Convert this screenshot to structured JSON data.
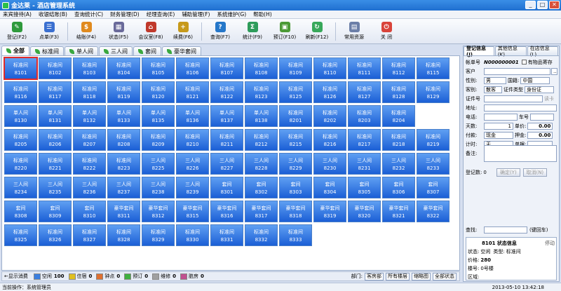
{
  "window": {
    "title": "金达莱 - 酒店管理系统"
  },
  "menu": [
    "来宾接待(A)",
    "收银结账(B)",
    "查询统计(C)",
    "财务管理(D)",
    "经理查询(E)",
    "辅助管理(F)",
    "系统维护(G)",
    "帮助(H)"
  ],
  "toolbar": [
    {
      "label": "登记(F2)",
      "icon": "register-icon",
      "color": "#2f9a3c"
    },
    {
      "label": "点单(F3)",
      "icon": "order-icon",
      "color": "#3a6fd0"
    },
    {
      "label": "结账(F4)",
      "icon": "checkout-icon",
      "color": "#e08a1e"
    },
    {
      "label": "状态(F5)",
      "icon": "status-icon",
      "color": "#6a6a9a"
    },
    {
      "label": "会议室(F8)",
      "icon": "meeting-icon",
      "color": "#c0392b"
    },
    {
      "label": "续费(F6)",
      "icon": "renew-icon",
      "color": "#c79a1a"
    },
    {
      "label": "查询(F7)",
      "icon": "query-icon",
      "color": "#2577c9"
    },
    {
      "label": "统计(F9)",
      "icon": "stats-icon",
      "color": "#2e9c5a"
    },
    {
      "label": "预订(F10)",
      "icon": "booking-icon",
      "color": "#4c9a36"
    },
    {
      "label": "刷新(F12)",
      "icon": "refresh-icon",
      "color": "#38a85a"
    },
    {
      "label": "常用资源",
      "icon": "resources-icon",
      "color": "#6c7fa8"
    },
    {
      "label": "关 闭",
      "icon": "close-app-icon",
      "color": "#d9443a"
    }
  ],
  "room_tabs": [
    "全部",
    "标准间",
    "单人间",
    "三人间",
    "套间",
    "豪华套间"
  ],
  "rooms": [
    {
      "t": "标准间",
      "n": "8101"
    },
    {
      "t": "标准间",
      "n": "8102"
    },
    {
      "t": "标准间",
      "n": "8103"
    },
    {
      "t": "标准间",
      "n": "8104"
    },
    {
      "t": "标准间",
      "n": "8105"
    },
    {
      "t": "标准间",
      "n": "8106"
    },
    {
      "t": "标准间",
      "n": "8107"
    },
    {
      "t": "标准间",
      "n": "8108"
    },
    {
      "t": "标准间",
      "n": "8109"
    },
    {
      "t": "标准间",
      "n": "8110"
    },
    {
      "t": "标准间",
      "n": "8111"
    },
    {
      "t": "标准间",
      "n": "8112"
    },
    {
      "t": "标准间",
      "n": "8115"
    },
    {
      "t": "标准间",
      "n": "8116"
    },
    {
      "t": "标准间",
      "n": "8117"
    },
    {
      "t": "标准间",
      "n": "8118"
    },
    {
      "t": "标准间",
      "n": "8119"
    },
    {
      "t": "标准间",
      "n": "8120"
    },
    {
      "t": "标准间",
      "n": "8121"
    },
    {
      "t": "标准间",
      "n": "8122"
    },
    {
      "t": "标准间",
      "n": "8123"
    },
    {
      "t": "标准间",
      "n": "8125"
    },
    {
      "t": "标准间",
      "n": "8126"
    },
    {
      "t": "标准间",
      "n": "8127"
    },
    {
      "t": "标准间",
      "n": "8128"
    },
    {
      "t": "标准间",
      "n": "8129"
    },
    {
      "t": "单人间",
      "n": "8130"
    },
    {
      "t": "单人间",
      "n": "8131"
    },
    {
      "t": "单人间",
      "n": "8132"
    },
    {
      "t": "单人间",
      "n": "8133"
    },
    {
      "t": "单人间",
      "n": "8135"
    },
    {
      "t": "单人间",
      "n": "8136"
    },
    {
      "t": "单人间",
      "n": "8137"
    },
    {
      "t": "单人间",
      "n": "8138"
    },
    {
      "t": "标准间",
      "n": "8201"
    },
    {
      "t": "标准间",
      "n": "8202"
    },
    {
      "t": "标准间",
      "n": "8203"
    },
    {
      "t": "标准间",
      "n": "8204"
    },
    {
      "t": "标准间",
      "n": "8205"
    },
    {
      "t": "标准间",
      "n": "8206"
    },
    {
      "t": "标准间",
      "n": "8207"
    },
    {
      "t": "标准间",
      "n": "8208"
    },
    {
      "t": "标准间",
      "n": "8209"
    },
    {
      "t": "标准间",
      "n": "8210"
    },
    {
      "t": "标准间",
      "n": "8211"
    },
    {
      "t": "标准间",
      "n": "8212"
    },
    {
      "t": "标准间",
      "n": "8215"
    },
    {
      "t": "标准间",
      "n": "8216"
    },
    {
      "t": "标准间",
      "n": "8217"
    },
    {
      "t": "标准间",
      "n": "8218"
    },
    {
      "t": "标准间",
      "n": "8219"
    },
    {
      "t": "标准间",
      "n": "8220"
    },
    {
      "t": "标准间",
      "n": "8221"
    },
    {
      "t": "标准间",
      "n": "8222"
    },
    {
      "t": "标准间",
      "n": "8223"
    },
    {
      "t": "三人间",
      "n": "8225"
    },
    {
      "t": "三人间",
      "n": "8226"
    },
    {
      "t": "三人间",
      "n": "8227"
    },
    {
      "t": "三人间",
      "n": "8228"
    },
    {
      "t": "三人间",
      "n": "8229"
    },
    {
      "t": "三人间",
      "n": "8230"
    },
    {
      "t": "三人间",
      "n": "8231"
    },
    {
      "t": "三人间",
      "n": "8232"
    },
    {
      "t": "三人间",
      "n": "8233"
    },
    {
      "t": "三人间",
      "n": "8234"
    },
    {
      "t": "三人间",
      "n": "8235"
    },
    {
      "t": "三人间",
      "n": "8236"
    },
    {
      "t": "三人间",
      "n": "8237"
    },
    {
      "t": "三人间",
      "n": "8238"
    },
    {
      "t": "三人间",
      "n": "8239"
    },
    {
      "t": "套间",
      "n": "8301"
    },
    {
      "t": "套间",
      "n": "8302"
    },
    {
      "t": "套间",
      "n": "8303"
    },
    {
      "t": "套间",
      "n": "8304"
    },
    {
      "t": "套间",
      "n": "8305"
    },
    {
      "t": "套间",
      "n": "8306"
    },
    {
      "t": "套间",
      "n": "8307"
    },
    {
      "t": "套间",
      "n": "8308"
    },
    {
      "t": "套间",
      "n": "8309"
    },
    {
      "t": "套间",
      "n": "8310"
    },
    {
      "t": "豪华套间",
      "n": "8311"
    },
    {
      "t": "豪华套间",
      "n": "8312"
    },
    {
      "t": "豪华套间",
      "n": "8315"
    },
    {
      "t": "豪华套间",
      "n": "8316"
    },
    {
      "t": "豪华套间",
      "n": "8317"
    },
    {
      "t": "豪华套间",
      "n": "8318"
    },
    {
      "t": "豪华套间",
      "n": "8319"
    },
    {
      "t": "豪华套间",
      "n": "8320"
    },
    {
      "t": "豪华套间",
      "n": "8321"
    },
    {
      "t": "豪华套间",
      "n": "8322"
    },
    {
      "t": "标准间",
      "n": "8325"
    },
    {
      "t": "标准间",
      "n": "8326"
    },
    {
      "t": "标准间",
      "n": "8327"
    },
    {
      "t": "标准间",
      "n": "8328"
    },
    {
      "t": "标准间",
      "n": "8329"
    },
    {
      "t": "标准间",
      "n": "8330"
    },
    {
      "t": "标准间",
      "n": "8331"
    },
    {
      "t": "标准间",
      "n": "8332"
    },
    {
      "t": "标准间",
      "n": "8333"
    }
  ],
  "legend": {
    "show_consume": "←显示消费",
    "items": [
      {
        "label": "空闲",
        "value": "100",
        "color": "#3b7fe0"
      },
      {
        "label": "住宿",
        "value": "0",
        "color": "#e0c020"
      },
      {
        "label": "钟点",
        "value": "0",
        "color": "#e07030"
      },
      {
        "label": "预订",
        "value": "0",
        "color": "#40b040"
      },
      {
        "label": "维修",
        "value": "0",
        "color": "#a0a0a0"
      },
      {
        "label": "脏房",
        "value": "0",
        "color": "#c05090"
      }
    ],
    "filter_label": "部门:",
    "filters": [
      "客房部",
      "所有楼层",
      "缩略图",
      "全部状态"
    ]
  },
  "statusbar": {
    "operator": "当前操作：系统管理员",
    "time": "2013-05-10 13:42:18"
  },
  "panel": {
    "tabs": [
      "登记信息(J)",
      "其他信息(K)",
      "在店信息(L)"
    ],
    "account_label": "帐单号",
    "account_no": "N000000001",
    "valuables": "有物品寄存",
    "customer_label": "客户",
    "gender_label": "性别:",
    "gender": "男",
    "nationality_label": "国籍:",
    "nationality": "中国",
    "guest_type_label": "客别:",
    "guest_type": "散客",
    "id_type_label": "证件类型",
    "id_type": "身份证",
    "id_no_label": "证件号",
    "read_card": "读卡",
    "address_label": "地址:",
    "phone_label": "电话:",
    "plate_label": "车号",
    "days_label": "天数:",
    "days": "1",
    "price_label": "单价:",
    "price": "0.00",
    "pay_label": "付款:",
    "pay": "现金",
    "deposit_label": "押金:",
    "deposit": "0.00",
    "timing_label": "计时:",
    "timing": "无",
    "bill_label": "单据:",
    "remark_label": "备注:",
    "count_label": "登记数:",
    "count": "0",
    "confirm": "确定(Y)",
    "cancel": "取消(N)",
    "search_label": "查找:",
    "hotel_map": "(键回车)",
    "info_room": "8101 状态信息",
    "info_state": "停动",
    "status_label": "状态:",
    "status": "空闲",
    "type_label": "类型:",
    "type": "标准间",
    "price2_label": "价格:",
    "price2": "280",
    "floor_label": "楼号:",
    "floor": "0号楼",
    "area_label": "区域:",
    "area": ""
  }
}
